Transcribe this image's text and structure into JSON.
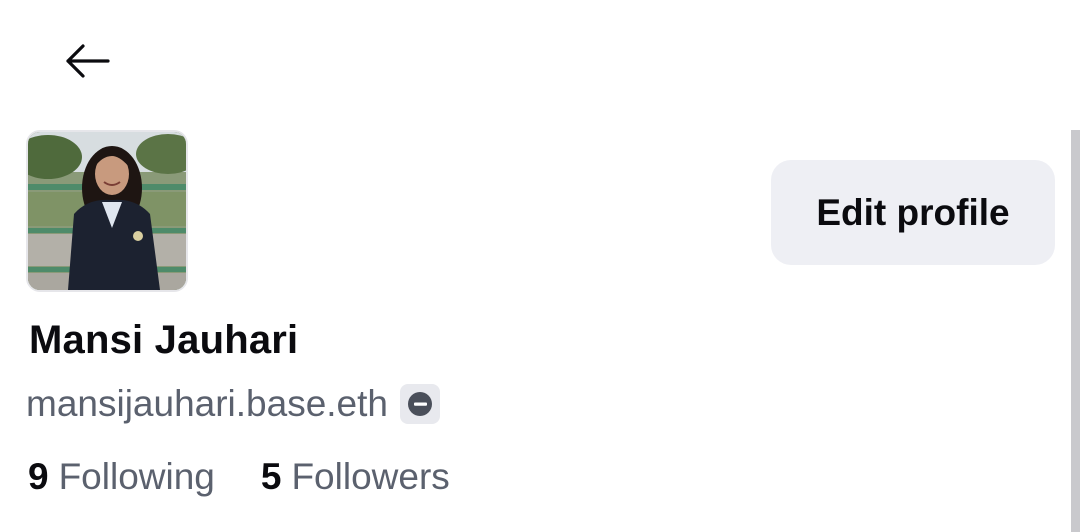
{
  "header": {
    "back_icon": "arrow-left-icon"
  },
  "profile": {
    "avatar_alt": "profile-photo",
    "display_name": "Mansi Jauhari",
    "handle": "mansijauhari.base.eth",
    "handle_badge_icon": "basename-badge-icon",
    "edit_button_label": "Edit profile",
    "following_count": "9",
    "following_label": "Following",
    "followers_count": "5",
    "followers_label": "Followers"
  },
  "colors": {
    "text_primary": "#0b0b0f",
    "text_secondary": "#5b616e",
    "button_bg": "#eeeff4",
    "badge_bg": "#e8e9ee",
    "scrollbar": "#c9c9cd"
  }
}
